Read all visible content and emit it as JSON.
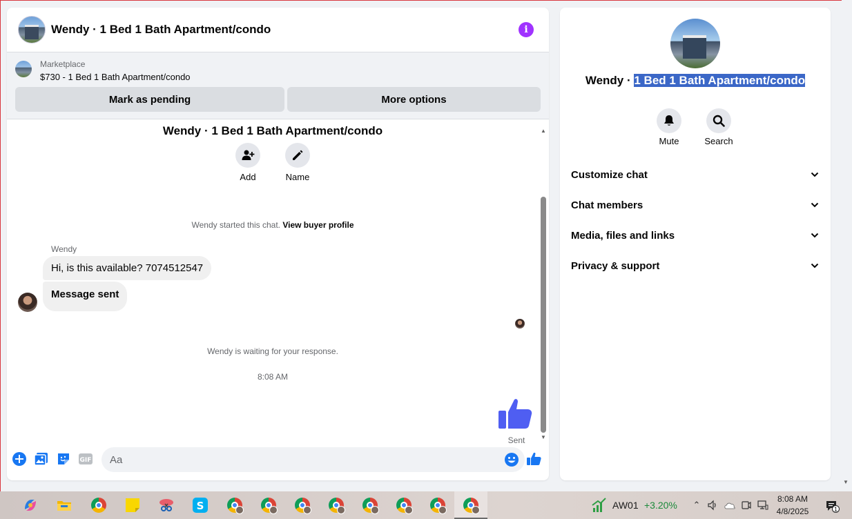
{
  "header": {
    "title": "Wendy · 1 Bed 1 Bath Apartment/condo",
    "info_icon": "info-icon"
  },
  "marketplace": {
    "label": "Marketplace",
    "listing": "$730 - 1 Bed 1 Bath Apartment/condo",
    "mark_pending_label": "Mark as pending",
    "more_options_label": "More options"
  },
  "conversation": {
    "title": "Wendy · 1 Bed 1 Bath Apartment/condo",
    "actions": [
      {
        "label": "Add",
        "icon": "add-person-icon"
      },
      {
        "label": "Name",
        "icon": "pencil-icon"
      }
    ],
    "started_text": "Wendy started this chat.",
    "buyer_profile_link": "View buyer profile",
    "sender_name": "Wendy",
    "messages": [
      "Hi, is this available? 7074512547",
      "Message sent"
    ],
    "waiting_text": "Wendy is waiting for your response.",
    "timestamp": "8:08 AM",
    "sent_label": "Sent"
  },
  "composer": {
    "placeholder": "Aa",
    "icons": [
      "plus-icon",
      "photo-icon",
      "sticker-icon",
      "gif-icon",
      "emoji-icon",
      "like-icon"
    ]
  },
  "info_panel": {
    "name_prefix": "Wendy · ",
    "name_highlight": "1 Bed 1 Bath Apartment/condo",
    "mute_label": "Mute",
    "search_label": "Search",
    "sections": [
      "Customize chat",
      "Chat members",
      "Media, files and links",
      "Privacy & support"
    ]
  },
  "taskbar": {
    "stock_name": "AW01",
    "stock_change": "+3.20%",
    "time": "8:08 AM",
    "date": "4/8/2025",
    "notification_count": "1"
  },
  "colors": {
    "accent": "#0084ff",
    "purple_info": "#a033ff",
    "like_blue": "#4f5ef2",
    "highlight": "#3b67c7"
  }
}
